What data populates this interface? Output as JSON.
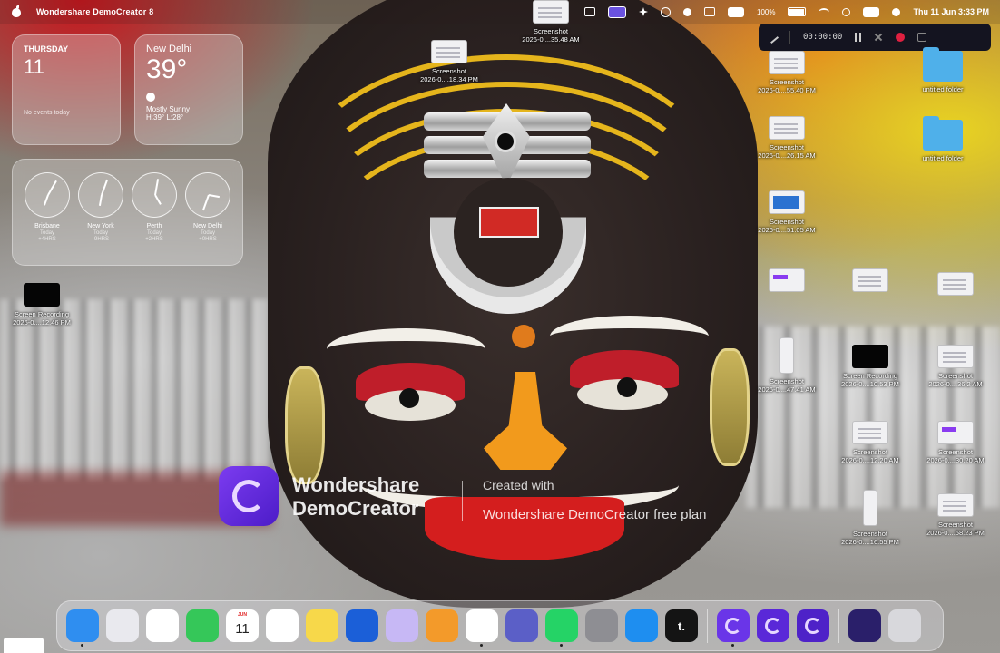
{
  "menubar": {
    "app_name": "Wondershare DemoCreator 8",
    "battery": "100%",
    "datetime": "Thu 11 Jun  3:33 PM"
  },
  "recording_toolbar": {
    "elapsed": "00:00:00"
  },
  "widgets": {
    "calendar": {
      "day": "THURSDAY",
      "date": "11",
      "events": "No events today"
    },
    "weather": {
      "city": "New Delhi",
      "temp": "39°",
      "condition": "Mostly Sunny",
      "high_low": "H:39° L:28°"
    },
    "clocks": [
      {
        "city": "Brisbane",
        "day": "Today",
        "offset": "+4HRS"
      },
      {
        "city": "New York",
        "day": "Today",
        "offset": "-9HRS"
      },
      {
        "city": "Perth",
        "day": "Today",
        "offset": "+2HRS"
      },
      {
        "city": "New Delhi",
        "day": "Today",
        "offset": "+0HRS"
      }
    ]
  },
  "desktop_items": [
    {
      "id": "d1",
      "name": "Screenshot",
      "sub": "2026-0....35.48 AM"
    },
    {
      "id": "d2",
      "name": "Screenshot",
      "sub": "2026-0....18.34 PM"
    },
    {
      "id": "d3",
      "name": "Screenshot",
      "sub": "2026-0....55.40 PM"
    },
    {
      "id": "d4",
      "name": "untitled folder",
      "sub": ""
    },
    {
      "id": "d5",
      "name": "Screenshot",
      "sub": "2026-0....26.15 AM"
    },
    {
      "id": "d6",
      "name": "untitled folder",
      "sub": ""
    },
    {
      "id": "d7",
      "name": "Screenshot",
      "sub": "2026-0....51.05 AM"
    },
    {
      "id": "d8",
      "name": "Screen Recording",
      "sub": "2026-0....12.46 PM"
    },
    {
      "id": "d9",
      "name": "Screenshot",
      "sub": "2026-0....47.41 AM"
    },
    {
      "id": "d10",
      "name": "Screen Recording",
      "sub": "2026-0....10.53 PM"
    },
    {
      "id": "d11",
      "name": "Screenshot",
      "sub": "2026-0....36.2 AM"
    },
    {
      "id": "d12",
      "name": "Screenshot",
      "sub": "2026-0....12.20 AM"
    },
    {
      "id": "d13",
      "name": "Screenshot",
      "sub": "2026-0....30.20 AM"
    },
    {
      "id": "d14",
      "name": "Screenshot",
      "sub": "2026-0....16.55 PM"
    },
    {
      "id": "d15",
      "name": "Screenshot",
      "sub": "2026-0....58.23 PM"
    }
  ],
  "watermark": {
    "brand_line1": "Wondershare",
    "brand_line2": "DemoCreator",
    "created_with": "Created with",
    "plan": "Wondershare DemoCreator free plan"
  },
  "dock": {
    "apps": [
      {
        "name": "Finder",
        "icon": "finder-icon",
        "color": "#2f8ef0"
      },
      {
        "name": "Launchpad",
        "icon": "launchpad-icon",
        "color": "#e9e9ee"
      },
      {
        "name": "Photos",
        "icon": "photos-icon",
        "color": "#ffffff"
      },
      {
        "name": "FaceTime",
        "icon": "facetime-icon",
        "color": "#35c759"
      },
      {
        "name": "Calendar",
        "icon": "calendar-icon",
        "color": "#ffffff",
        "label": "JUN",
        "number": "11"
      },
      {
        "name": "Reminders",
        "icon": "reminders-icon",
        "color": "#ffffff"
      },
      {
        "name": "Notes",
        "icon": "notes-icon",
        "color": "#f7d84a"
      },
      {
        "name": "Keynote",
        "icon": "keynote-icon",
        "color": "#1b5fd8"
      },
      {
        "name": "Freeform",
        "icon": "freeform-icon",
        "color": "#c7b8f5"
      },
      {
        "name": "Pages",
        "icon": "pages-icon",
        "color": "#f39a2a"
      },
      {
        "name": "Chrome",
        "icon": "chrome-icon",
        "color": "#ffffff"
      },
      {
        "name": "Teams",
        "icon": "teams-icon",
        "color": "#5b5fc7"
      },
      {
        "name": "WhatsApp",
        "icon": "whatsapp-icon",
        "color": "#25d366"
      },
      {
        "name": "System Settings",
        "icon": "settings-icon",
        "color": "#8e8e93"
      },
      {
        "name": "App Store",
        "icon": "appstore-icon",
        "color": "#1e8ef0"
      },
      {
        "name": "Tubi",
        "icon": "tubi-icon",
        "color": "#141414",
        "label": "t."
      },
      {
        "name": "DemoCreator",
        "icon": "democreator-icon",
        "color": "#6a35e8"
      },
      {
        "name": "DemoCreator Recorder",
        "icon": "democreator-icon",
        "color": "#5a28d8"
      },
      {
        "name": "DemoCreator Editor",
        "icon": "democreator-icon",
        "color": "#4e22c8"
      },
      {
        "name": "Screen Preview",
        "icon": "screen-preview-icon",
        "color": "#2a1f6a"
      },
      {
        "name": "Trash",
        "icon": "trash-icon",
        "color": "#d8d8dc"
      }
    ]
  }
}
